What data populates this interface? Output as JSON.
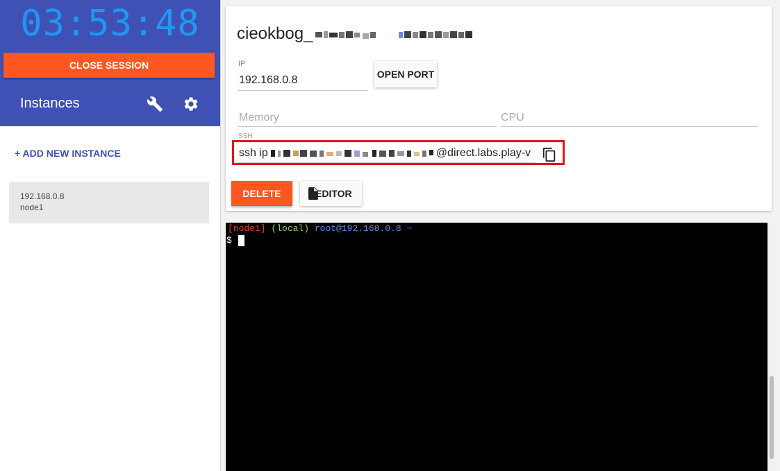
{
  "sidebar": {
    "timer": "03:53:48",
    "close_session_label": "CLOSE SESSION",
    "instances_title": "Instances",
    "add_instance_label": "+ ADD NEW INSTANCE",
    "instances": [
      {
        "ip": "192.168.0.8",
        "name": "node1"
      }
    ]
  },
  "card": {
    "title": "cieokbog_",
    "ip_label": "IP",
    "ip_value": "192.168.0.8",
    "open_port_label": "OPEN PORT",
    "memory_label": "Memory",
    "cpu_label": "CPU",
    "ssh_label": "SSH",
    "ssh_prefix": "ssh ip",
    "ssh_suffix": "@direct.labs.play-v",
    "delete_label": "DELETE",
    "editor_label": "EDITOR"
  },
  "terminal": {
    "node": "[node1]",
    "env": "(local)",
    "host": "root@192.168.0.8",
    "path": "~",
    "prompt": "$"
  },
  "colors": {
    "header_bg": "#3f51b5",
    "timer": "#2196f3",
    "accent_orange": "#ff5722",
    "highlight_red": "#e2141c",
    "term_node": "#e53935",
    "term_env": "#9ccc65",
    "term_host": "#5c8ee6"
  },
  "icons": [
    "wrench-icon",
    "gear-icon",
    "copy-icon",
    "file-icon"
  ]
}
